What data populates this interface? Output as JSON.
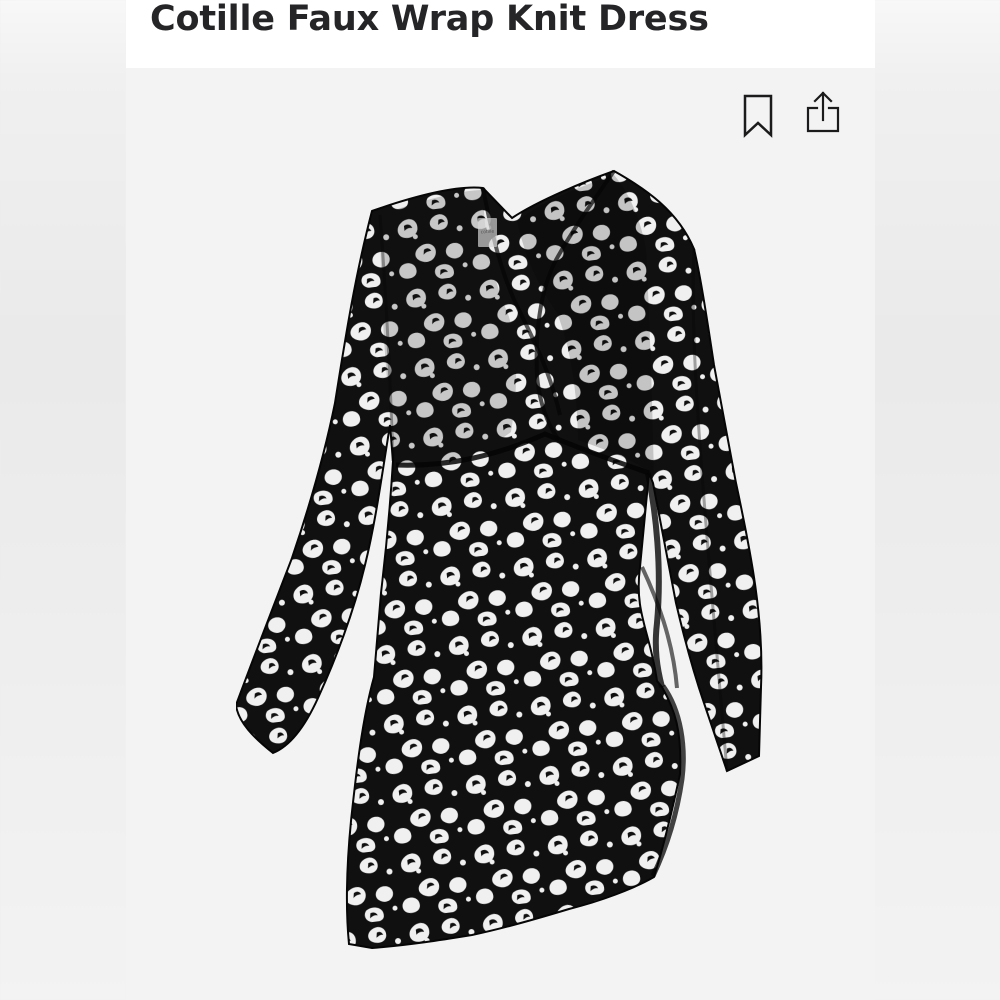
{
  "product": {
    "title": "Cotille Faux Wrap Knit Dress"
  },
  "actions": {
    "bookmark_icon": "bookmark-icon",
    "share_icon": "share-icon"
  },
  "image": {
    "subject": "long-sleeve-wrap-dress",
    "label_text": "cotille"
  },
  "colors": {
    "title_text": "#252528",
    "panel_background": "#f3f3f4",
    "title_background": "#ffffff",
    "dress_black": "#101010",
    "print_white": "#f0f0f0"
  }
}
